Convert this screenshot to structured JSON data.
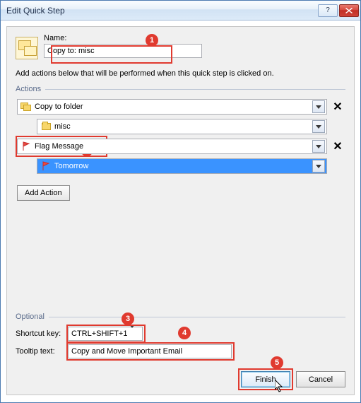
{
  "window": {
    "title": "Edit Quick Step"
  },
  "name": {
    "label": "Name:",
    "value": "Copy to: misc"
  },
  "instructions": "Add actions below that will be performed when this quick step is clicked on.",
  "sections": {
    "actions": "Actions",
    "optional": "Optional"
  },
  "actions": {
    "copy_to_folder": "Copy to folder",
    "misc": "misc",
    "flag_message": "Flag Message",
    "tomorrow": "Tomorrow"
  },
  "buttons": {
    "add_action": "Add Action",
    "finish": "Finish",
    "cancel": "Cancel"
  },
  "optional": {
    "shortcut_label": "Shortcut key:",
    "shortcut_value": "CTRL+SHIFT+1",
    "tooltip_label": "Tooltip text:",
    "tooltip_value": "Copy and Move Important Email"
  },
  "callouts": {
    "c1": "1",
    "c2": "2",
    "c3": "3",
    "c4": "4",
    "c5": "5"
  }
}
